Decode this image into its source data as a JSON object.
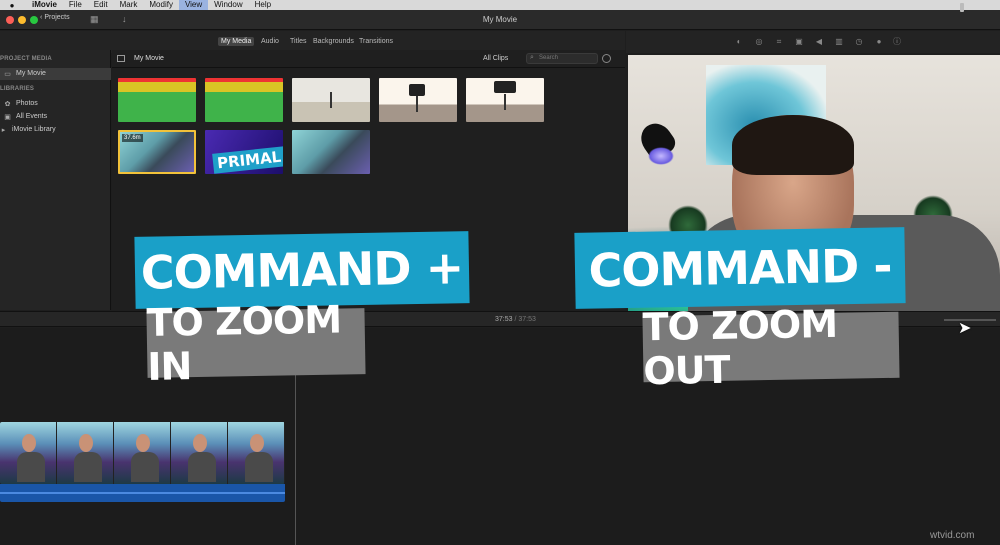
{
  "menu": {
    "items": [
      "iMovie",
      "File",
      "Edit",
      "Mark",
      "Modify",
      "View",
      "Window",
      "Help"
    ]
  },
  "toolbar": {
    "back_label": "Projects",
    "window_title": "My Movie"
  },
  "browser_tabs": [
    "My Media",
    "Audio",
    "Titles",
    "Backgrounds",
    "Transitions"
  ],
  "sidebar": {
    "project_media_header": "PROJECT MEDIA",
    "project_item": "My Movie",
    "libraries_header": "LIBRARIES",
    "items": [
      "Photos",
      "All Events",
      "iMovie Library"
    ]
  },
  "browser": {
    "title": "My Movie",
    "filter": "All Clips",
    "search_placeholder": "Search",
    "selected_clip_duration": "37.6m",
    "primal_text": "PRIMAL"
  },
  "timeline": {
    "current_time": "37:53",
    "separator": "/",
    "total_time": "37:53"
  },
  "overlay": {
    "left_main": "COMMAND +",
    "left_sub": "TO ZOOM IN",
    "right_main": "COMMAND -",
    "right_sub": "TO ZOOM OUT"
  },
  "watermark": "wtvid.com",
  "colors": {
    "accent_caption": "#1aa0c8",
    "selection": "#f2c23a"
  }
}
